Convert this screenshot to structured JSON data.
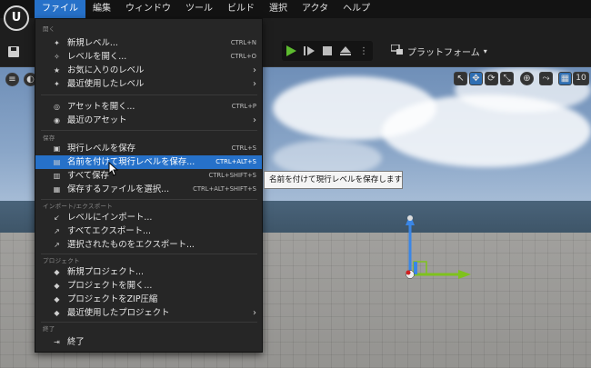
{
  "logo": "U",
  "menubar": {
    "items": [
      {
        "label": "ファイル",
        "open": true
      },
      {
        "label": "編集"
      },
      {
        "label": "ウィンドウ"
      },
      {
        "label": "ツール"
      },
      {
        "label": "ビルド"
      },
      {
        "label": "選択"
      },
      {
        "label": "アクタ"
      },
      {
        "label": "ヘルプ"
      }
    ]
  },
  "toolbar": {
    "platform_label": "プラットフォーム",
    "platform_icon": "platform-icon",
    "play_icons": [
      "play-icon",
      "step-icon",
      "stop-icon",
      "eject-icon"
    ]
  },
  "viewport": {
    "grid_value": "10"
  },
  "file_menu": {
    "sections": [
      {
        "header": "開く"
      },
      {
        "header": "保存"
      },
      {
        "header": "インポート/エクスポート"
      },
      {
        "header": "プロジェクト"
      },
      {
        "header": "終了"
      }
    ],
    "items": [
      {
        "label": "新規レベル...",
        "shortcut": "CTRL+N",
        "icon": "new-level-icon"
      },
      {
        "label": "レベルを開く...",
        "shortcut": "CTRL+O",
        "icon": "open-level-icon"
      },
      {
        "label": "お気に入りのレベル",
        "submenu": "›",
        "icon": "favorite-icon"
      },
      {
        "label": "最近使用したレベル",
        "submenu": "›",
        "icon": "recent-icon"
      },
      {
        "label": "アセットを開く...",
        "shortcut": "CTRL+P",
        "icon": "open-asset-icon"
      },
      {
        "label": "最近のアセット",
        "submenu": "›",
        "icon": "recent-asset-icon"
      },
      {
        "label": "現行レベルを保存",
        "shortcut": "CTRL+S",
        "icon": "save-icon"
      },
      {
        "label": "名前を付けて現行レベルを保存...",
        "shortcut": "CTRL+ALT+S",
        "icon": "save-as-icon",
        "highlighted": true
      },
      {
        "label": "すべて保存",
        "shortcut": "CTRL+SHIFT+S",
        "icon": "save-all-icon"
      },
      {
        "label": "保存するファイルを選択...",
        "shortcut": "CTRL+ALT+SHIFT+S",
        "icon": "choose-save-icon"
      },
      {
        "label": "レベルにインポート...",
        "icon": "import-icon"
      },
      {
        "label": "すべてエクスポート...",
        "icon": "export-all-icon"
      },
      {
        "label": "選択されたものをエクスポート...",
        "icon": "export-selected-icon"
      },
      {
        "label": "新規プロジェクト...",
        "icon": "new-project-icon"
      },
      {
        "label": "プロジェクトを開く...",
        "icon": "open-project-icon"
      },
      {
        "label": "プロジェクトをZIP圧縮",
        "icon": "zip-icon"
      },
      {
        "label": "最近使用したプロジェクト",
        "submenu": "›",
        "icon": "recent-project-icon"
      },
      {
        "label": "終了",
        "icon": "exit-icon"
      }
    ]
  },
  "tooltip": {
    "text": "名前を付けて現行レベルを保存します"
  },
  "colors": {
    "accent": "#2671c9",
    "menu_bg": "#262626",
    "gizmo_x": "#7ec21c",
    "gizmo_z": "#3a86e6"
  }
}
